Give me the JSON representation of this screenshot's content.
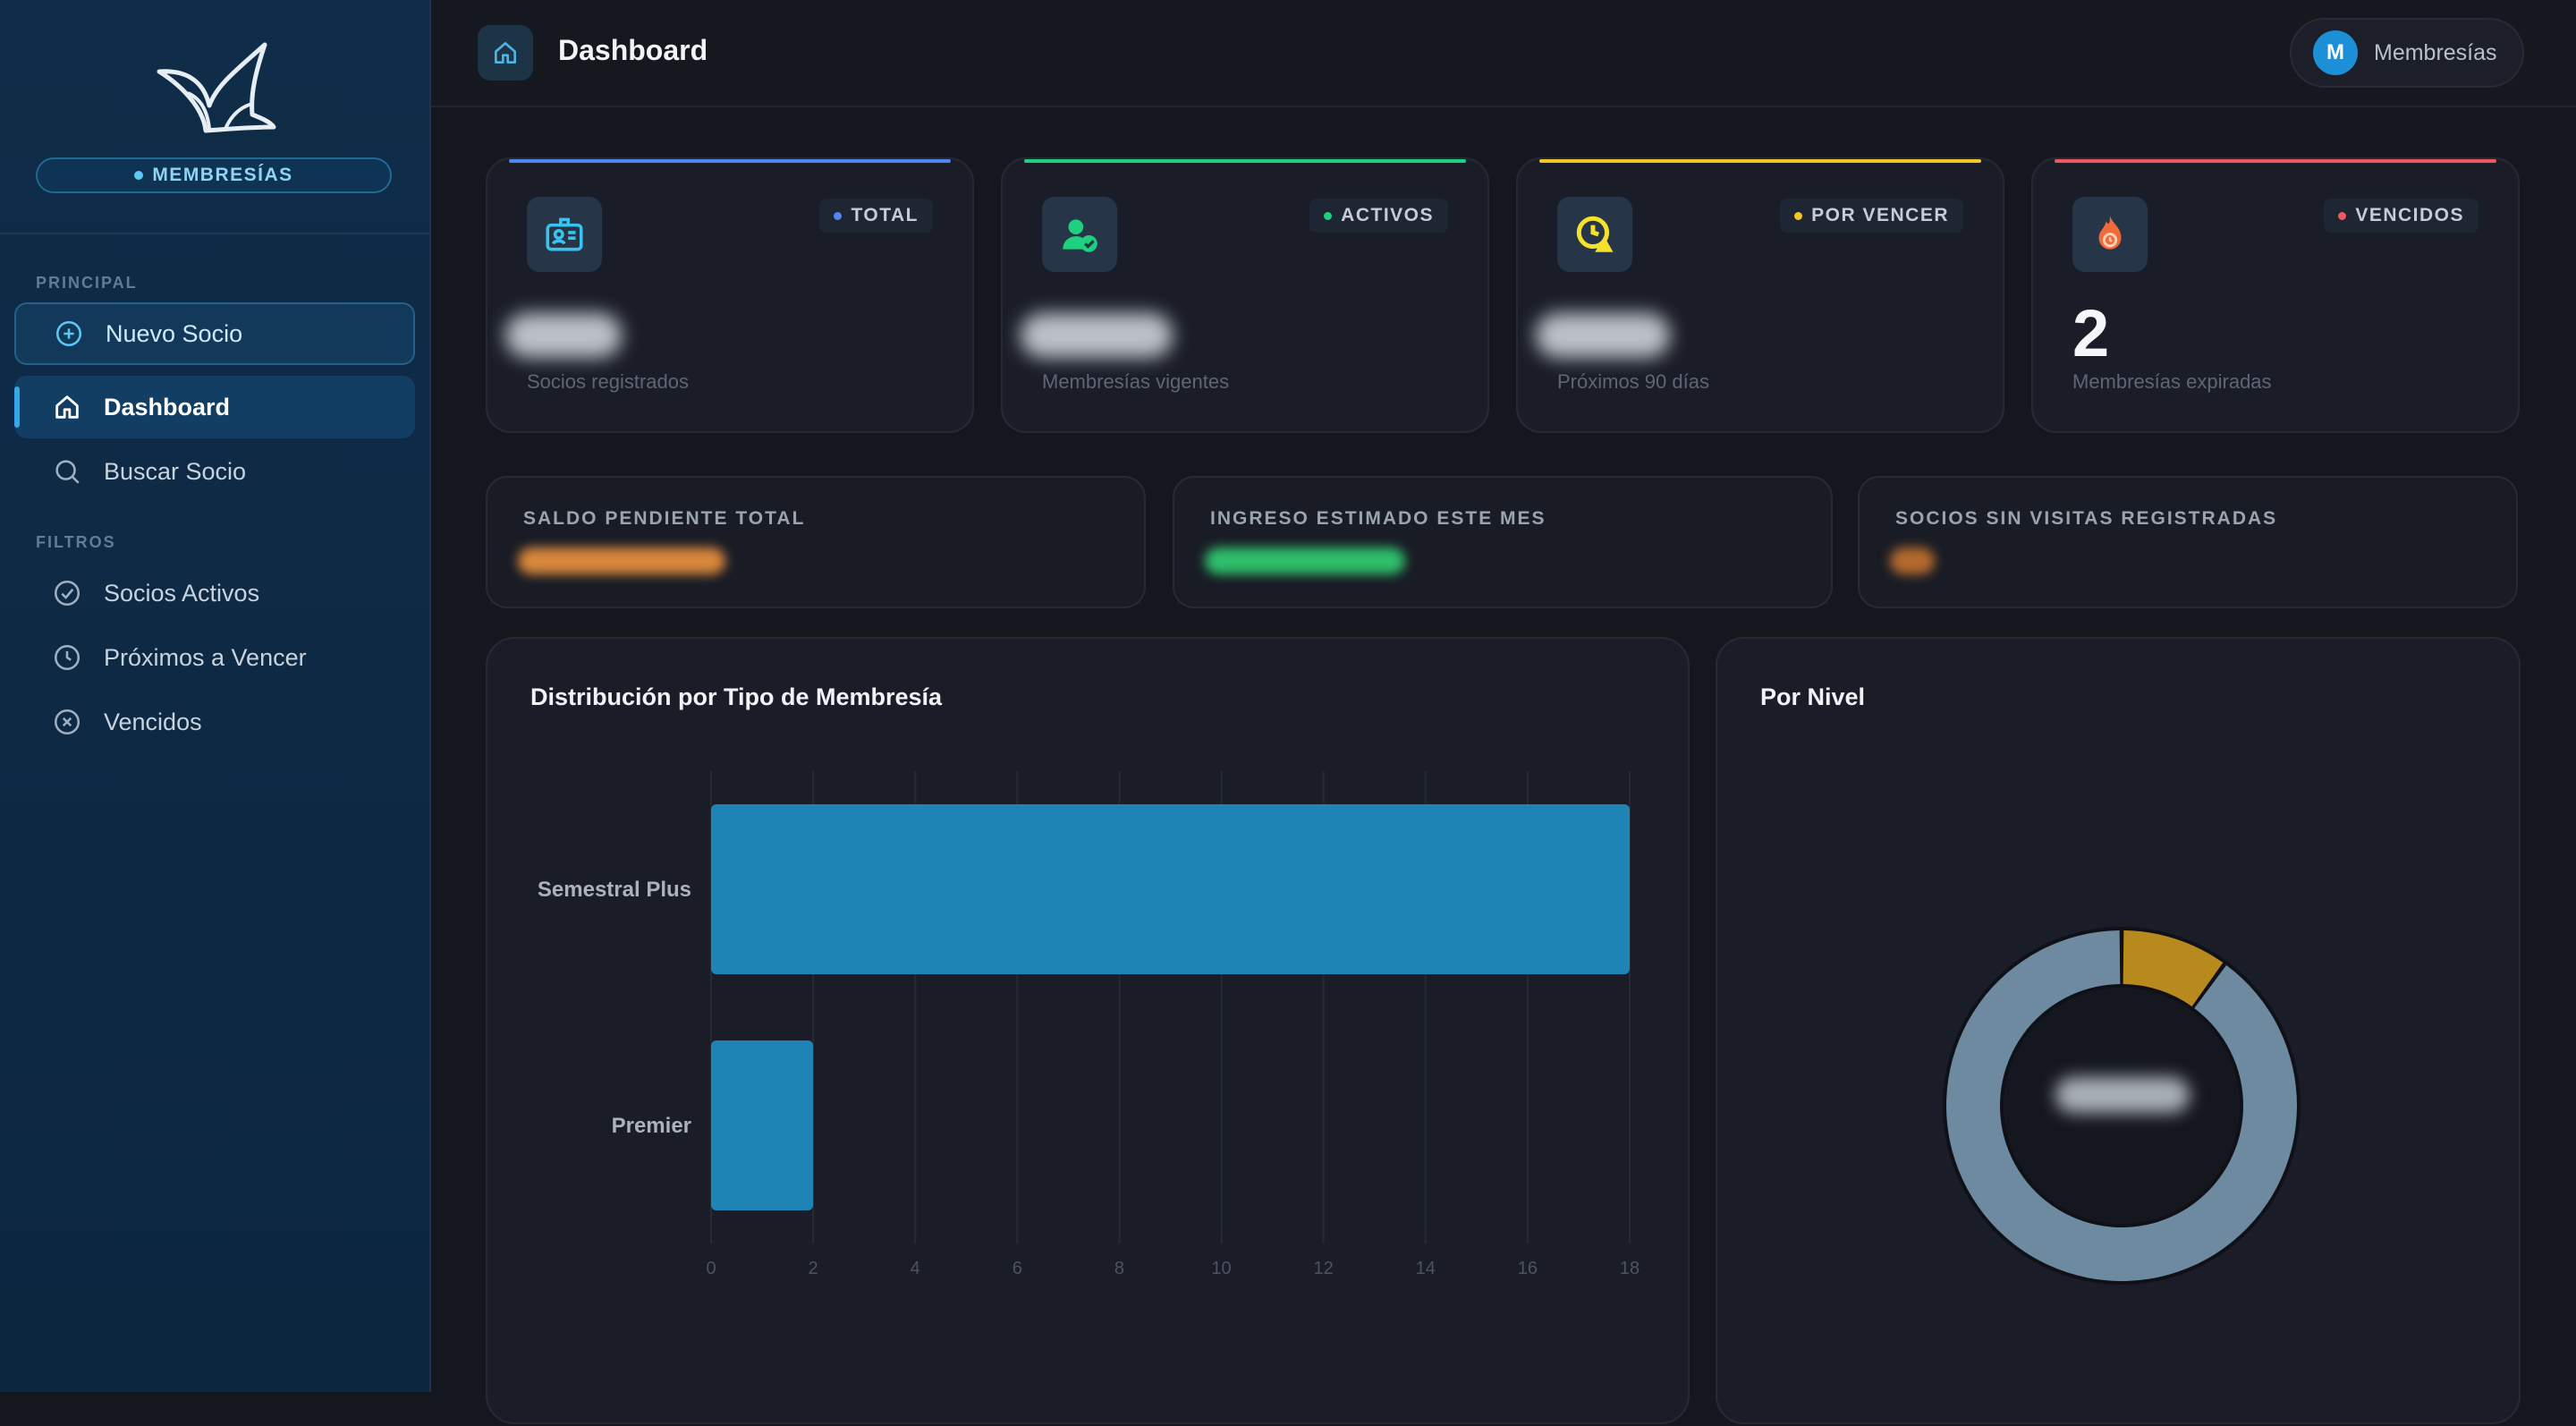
{
  "sidebar": {
    "brand": "MEMBRESÍAS",
    "sections": {
      "principal": "PRINCIPAL",
      "filtros": "FILTROS"
    },
    "items": [
      {
        "label": "Nuevo Socio",
        "icon": "plus-circle-icon"
      },
      {
        "label": "Dashboard",
        "icon": "home-icon",
        "active": true
      },
      {
        "label": "Buscar Socio",
        "icon": "search-icon"
      },
      {
        "label": "Socios Activos",
        "icon": "check-circle-icon"
      },
      {
        "label": "Próximos a Vencer",
        "icon": "clock-icon"
      },
      {
        "label": "Vencidos",
        "icon": "x-circle-icon"
      }
    ]
  },
  "header": {
    "title": "Dashboard",
    "user_initial": "M",
    "user_label": "Membresías"
  },
  "stats": [
    {
      "tag": "TOTAL",
      "value": "",
      "sub": "Socios registrados",
      "color": "#4f86f0",
      "icon": "id-card-icon"
    },
    {
      "tag": "ACTIVOS",
      "value": "",
      "sub": "Membresías vigentes",
      "color": "#1fd07e",
      "icon": "user-check-icon"
    },
    {
      "tag": "POR VENCER",
      "value": "",
      "sub": "Próximos 90 días",
      "color": "#f3c627",
      "icon": "alert-clock-icon"
    },
    {
      "tag": "VENCIDOS",
      "value": "2",
      "sub": "Membresías expiradas",
      "color": "#f0575f",
      "icon": "flame-timer-icon"
    }
  ],
  "mini_cards": [
    {
      "label": "SALDO PENDIENTE TOTAL",
      "color": "#d9873c"
    },
    {
      "label": "INGRESO ESTIMADO ESTE MES",
      "color": "#2fbf6b"
    },
    {
      "label": "SOCIOS SIN VISITAS REGISTRADAS",
      "color": "#b56a2e"
    }
  ],
  "panels": {
    "bar_title": "Distribución por Tipo de Membresía",
    "donut_title": "Por Nivel"
  },
  "chart_data": [
    {
      "type": "bar",
      "orientation": "horizontal",
      "title": "Distribución por Tipo de Membresía",
      "categories": [
        "Semestral Plus",
        "Premier"
      ],
      "values": [
        18,
        2
      ],
      "xlim": [
        0,
        18
      ],
      "xticks": [
        0,
        2,
        4,
        6,
        8,
        10,
        12,
        14,
        16,
        18
      ],
      "grid": true,
      "color": "#1e84b5"
    },
    {
      "type": "pie",
      "title": "Por Nivel",
      "style": "donut",
      "values": [
        10,
        90
      ],
      "colors": [
        "#b88a1d",
        "#6d8aa1"
      ]
    }
  ]
}
